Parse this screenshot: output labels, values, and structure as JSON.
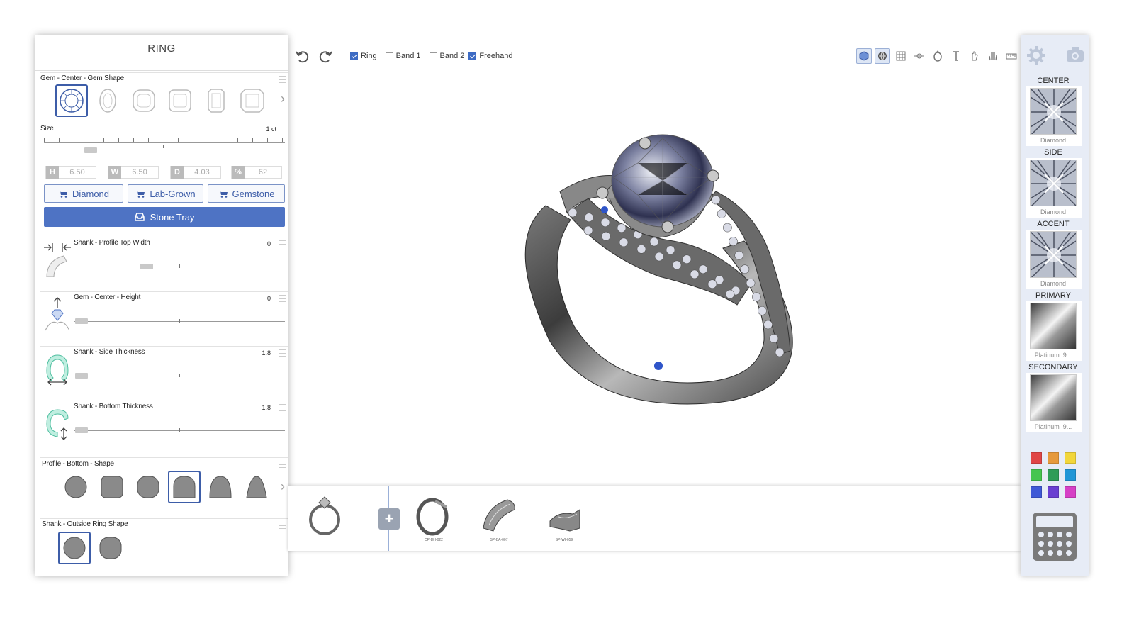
{
  "left_panel": {
    "title": "RING",
    "gem_shape": {
      "label": "Gem - Center - Gem Shape",
      "shapes": [
        "round",
        "oval",
        "cushion",
        "cushion-square",
        "emerald",
        "asscher"
      ],
      "selected": 0
    },
    "size": {
      "label": "Size",
      "value": "1 ct"
    },
    "dimensions": [
      {
        "letter": "H",
        "value": "6.50"
      },
      {
        "letter": "W",
        "value": "6.50"
      },
      {
        "letter": "D",
        "value": "4.03"
      },
      {
        "letter": "%",
        "value": "62"
      }
    ],
    "buy_buttons": [
      {
        "label": "Diamond"
      },
      {
        "label": "Lab-Grown"
      },
      {
        "label": "Gemstone"
      }
    ],
    "stone_tray_label": "Stone Tray",
    "params": [
      {
        "label": "Shank - Profile Top Width",
        "value": "0"
      },
      {
        "label": "Gem - Center - Height",
        "value": "0"
      },
      {
        "label": "Shank - Side Thickness",
        "value": "1.8"
      },
      {
        "label": "Shank - Bottom Thickness",
        "value": "1.8"
      }
    ],
    "profile_bottom": {
      "label": "Profile - Bottom - Shape",
      "selected": 3
    },
    "outside_shape": {
      "label": "Shank - Outside Ring Shape",
      "selected": 0
    }
  },
  "toolbar": {
    "checkboxes": [
      {
        "label": "Ring",
        "checked": true
      },
      {
        "label": "Band 1",
        "checked": false
      },
      {
        "label": "Band 2",
        "checked": false
      },
      {
        "label": "Freehand",
        "checked": true
      }
    ]
  },
  "bottom_strip": {
    "parts": [
      {
        "code": ""
      },
      {
        "code": "CP-DH-022"
      },
      {
        "code": "SP-BA-007"
      },
      {
        "code": "SP-WI-059"
      }
    ]
  },
  "right_panel": {
    "materials": [
      {
        "label": "CENTER",
        "name": "Diamond",
        "kind": "diamond"
      },
      {
        "label": "SIDE",
        "name": "Diamond",
        "kind": "diamond"
      },
      {
        "label": "ACCENT",
        "name": "Diamond",
        "kind": "diamond"
      },
      {
        "label": "PRIMARY",
        "name": "Platinum .9...",
        "kind": "metal"
      },
      {
        "label": "SECONDARY",
        "name": "Platinum .9...",
        "kind": "metal"
      }
    ],
    "colors": [
      "#e04646",
      "#e69a3c",
      "#f2d63a",
      "#46c54f",
      "#2f9c58",
      "#2196d6",
      "#3f59d6",
      "#6a3fd1",
      "#d640c6"
    ]
  }
}
